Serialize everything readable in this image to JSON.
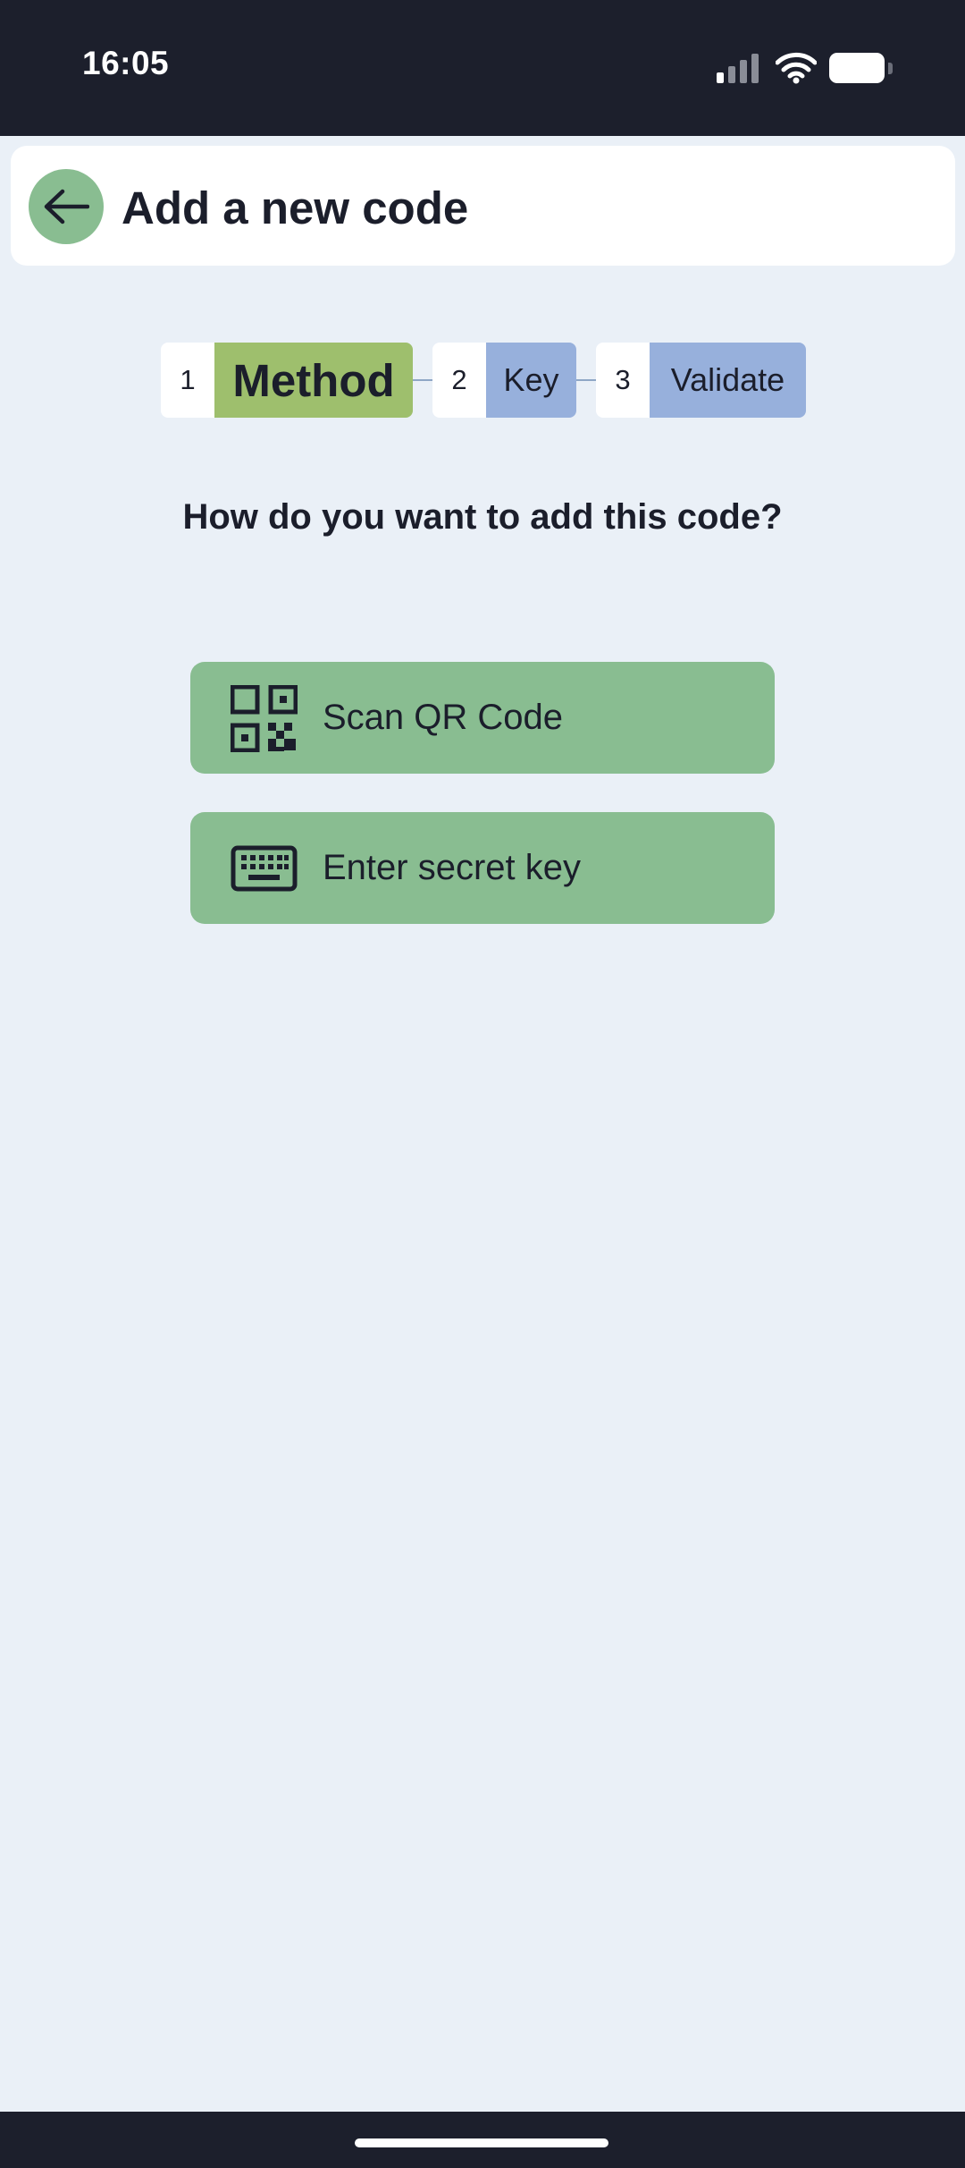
{
  "status_bar": {
    "time": "16:05",
    "signal_icon": "cellular-signal-icon",
    "wifi_icon": "wifi-icon",
    "battery_icon": "battery-icon"
  },
  "header": {
    "back_icon": "arrow-left-icon",
    "title": "Add a new code"
  },
  "stepper": {
    "steps": [
      {
        "number": "1",
        "label": "Method",
        "state": "active"
      },
      {
        "number": "2",
        "label": "Key",
        "state": "upcoming"
      },
      {
        "number": "3",
        "label": "Validate",
        "state": "upcoming"
      }
    ]
  },
  "main": {
    "question": "How do you want to add this code?",
    "options": [
      {
        "icon": "qr-code-icon",
        "label": "Scan QR Code"
      },
      {
        "icon": "keyboard-icon",
        "label": "Enter secret key"
      }
    ]
  },
  "colors": {
    "system_bar": "#1c1f2c",
    "background": "#eaf0f7",
    "accent_green": "#89bd91",
    "active_step": "#9ebf6d",
    "inactive_step": "#97b0dc",
    "text": "#1b1e2b"
  }
}
